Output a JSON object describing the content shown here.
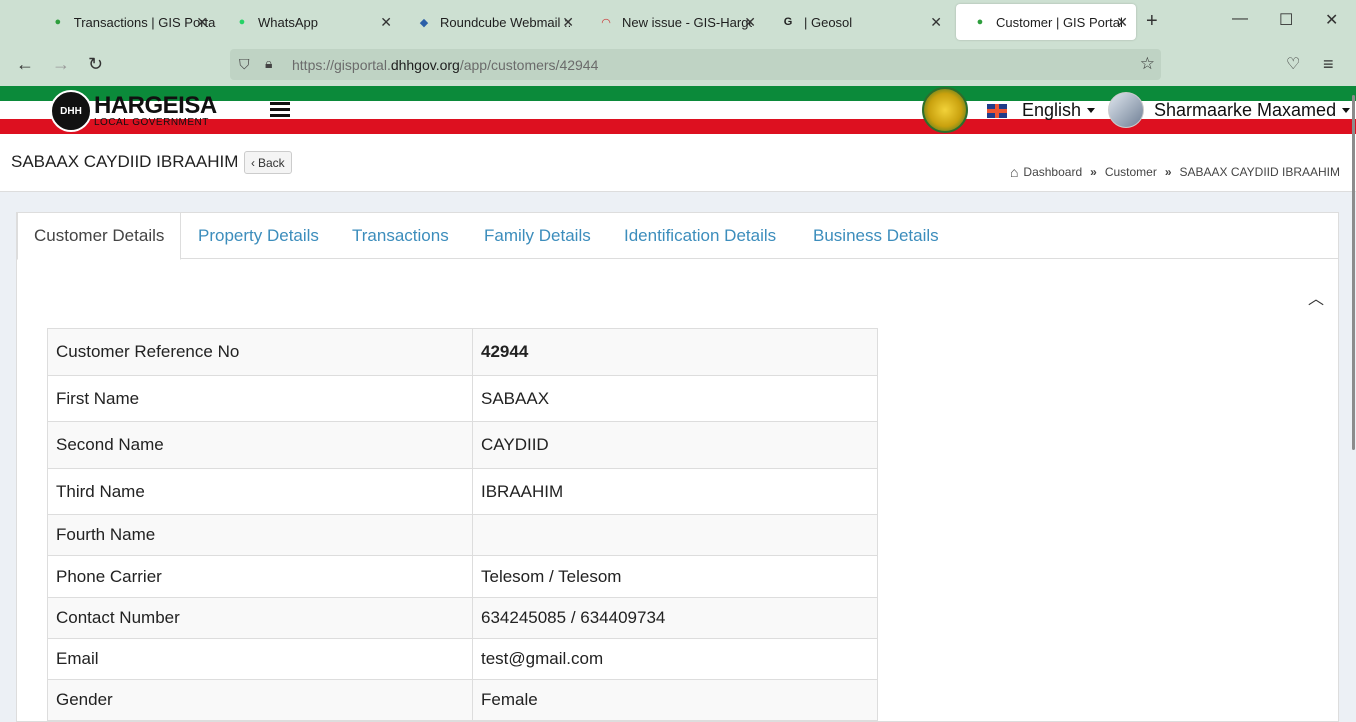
{
  "browser": {
    "tabs": [
      {
        "label": "Transactions | GIS Portal",
        "icon": "gis-portal-icon",
        "active": false
      },
      {
        "label": "WhatsApp",
        "icon": "whatsapp-icon",
        "active": false
      },
      {
        "label": "Roundcube Webmail :: In",
        "icon": "roundcube-icon",
        "active": false
      },
      {
        "label": "New issue - GIS-Hargeisa",
        "icon": "gitlab-icon",
        "active": false
      },
      {
        "label": "| Geosol",
        "icon": "geosol-icon",
        "active": false
      },
      {
        "label": "Customer | GIS Portal",
        "icon": "gis-portal-icon",
        "active": true
      }
    ],
    "url_prefix": "https://gisportal.",
    "url_domain": "dhhgov.org",
    "url_path": "/app/customers/42944"
  },
  "header": {
    "logo_name": "HARGEISA",
    "logo_sub": "LOCAL GOVERNMENT",
    "logo_badge": "DHH",
    "language": "English",
    "user_name": "Sharmaarke Maxamed"
  },
  "page": {
    "title": "SABAAX CAYDIID IBRAAHIM",
    "back_label": "Back",
    "breadcrumb": [
      "Dashboard",
      "Customer",
      "SABAAX CAYDIID IBRAAHIM"
    ]
  },
  "tabs": [
    {
      "label": "Customer Details",
      "active": true
    },
    {
      "label": "Property Details",
      "active": false
    },
    {
      "label": "Transactions",
      "active": false
    },
    {
      "label": "Family Details",
      "active": false
    },
    {
      "label": "Identification Details",
      "active": false
    },
    {
      "label": "Business Details",
      "active": false
    }
  ],
  "details": [
    {
      "label": "Customer Reference No",
      "value": "42944",
      "bold": true
    },
    {
      "label": "First Name",
      "value": "SABAAX"
    },
    {
      "label": "Second Name",
      "value": "CAYDIID"
    },
    {
      "label": "Third Name",
      "value": "IBRAAHIM"
    },
    {
      "label": "Fourth Name",
      "value": ""
    },
    {
      "label": "Phone Carrier",
      "value": "Telesom / Telesom"
    },
    {
      "label": "Contact Number",
      "value": "634245085 / 634409734"
    },
    {
      "label": "Email",
      "value": "test@gmail.com"
    },
    {
      "label": "Gender",
      "value": "Female"
    }
  ],
  "colors": {
    "accent": "#3c8dbc",
    "green": "#0b8a3a",
    "red": "#dd1020"
  }
}
